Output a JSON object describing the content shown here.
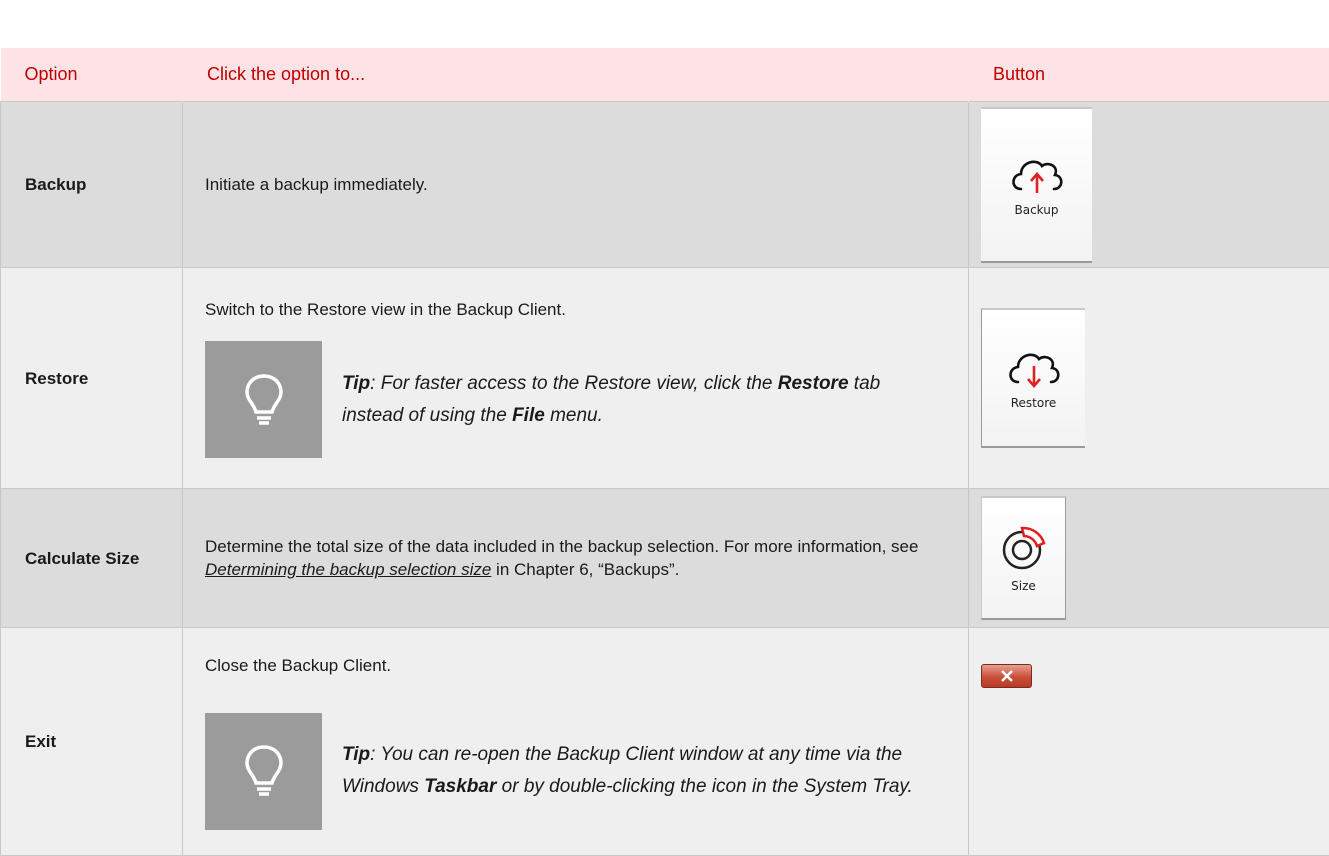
{
  "header": {
    "col_option": "Option",
    "col_click": "Click the option to...",
    "col_button": "Button"
  },
  "rows": [
    {
      "option": "Backup",
      "description": "Initiate a backup immediately.",
      "button_label": "Backup",
      "icon": "cloud-upload-icon"
    },
    {
      "option": "Restore",
      "description": "Switch to the Restore view in the Backup Client.",
      "tip": {
        "lead": "Tip",
        "text1": ": For faster access to the Restore view, click the ",
        "bold1": "Restore",
        "text2": " tab instead of using the ",
        "bold2": "File",
        "text3": " menu."
      },
      "button_label": "Restore",
      "icon": "cloud-download-icon"
    },
    {
      "option": "Calculate Size",
      "description_pre": "Determine the total size of the data included in the backup selection. For more information, see ",
      "link": "Determining the backup selection size",
      "description_post": " in Chapter 6, “Backups”.",
      "button_label": "Size",
      "icon": "size-ring-icon"
    },
    {
      "option": "Exit",
      "description": "Close the Backup Client.",
      "tip": {
        "lead": "Tip",
        "text1": ": You can re-open the Backup Client window at any time via the Windows ",
        "bold1": "Taskbar",
        "text2": " or by double-clicking the icon in the System Tray."
      },
      "icon": "close-icon"
    }
  ],
  "colors": {
    "header_bg": "#fde3e6",
    "header_text": "#c00000",
    "accent_red": "#e02020"
  }
}
